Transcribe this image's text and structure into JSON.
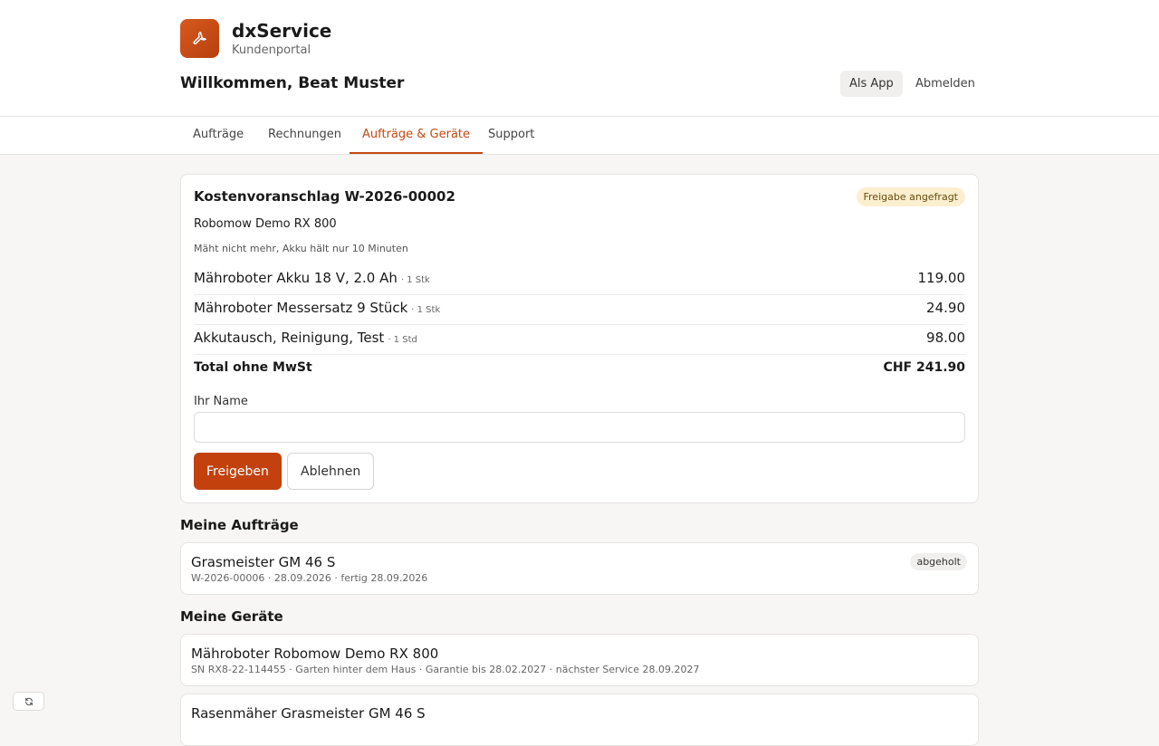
{
  "brand": {
    "name": "dxService",
    "subtitle": "Kundenportal",
    "accent_color": "#c2410c",
    "logo_icon": "wrench-icon"
  },
  "header": {
    "welcome": "Willkommen, Beat Muster",
    "app_button": "Als App",
    "logout_button": "Abmelden"
  },
  "tabs": [
    {
      "label": "Aufträge",
      "active": false
    },
    {
      "label": "Rechnungen",
      "active": false
    },
    {
      "label": "Aufträge & Geräte",
      "active": true
    },
    {
      "label": "Support",
      "active": false
    }
  ],
  "quote": {
    "title": "Kostenvoranschlag W-2026-00002",
    "status": "Freigabe angefragt",
    "device": "Robomow Demo RX 800",
    "issue": "Mäht nicht mehr, Akku hält nur 10 Minuten",
    "items": [
      {
        "name": "Mähroboter Akku 18 V, 2.0 Ah",
        "qty": "· 1 Stk",
        "price": "119.00"
      },
      {
        "name": "Mähroboter Messersatz 9 Stück",
        "qty": "· 1 Stk",
        "price": "24.90"
      },
      {
        "name": "Akkutausch, Reinigung, Test",
        "qty": "· 1 Std",
        "price": "98.00"
      }
    ],
    "total_label": "Total ohne MwSt",
    "total_value": "CHF 241.90",
    "name_label": "Ihr Name",
    "name_value": "",
    "approve_button": "Freigeben",
    "reject_button": "Ablehnen"
  },
  "orders": {
    "title": "Meine Aufträge",
    "items": [
      {
        "title": "Grasmeister GM 46 S",
        "meta": "W-2026-00006 · 28.09.2026 · fertig 28.09.2026",
        "badge": "abgeholt"
      }
    ]
  },
  "devices": {
    "title": "Meine Geräte",
    "items": [
      {
        "title": "Mähroboter Robomow Demo RX 800",
        "meta": "SN RX8-22-114455 · Garten hinter dem Haus · Garantie bis 28.02.2027 · nächster Service 28.09.2027"
      },
      {
        "title": "Rasenmäher Grasmeister GM 46 S",
        "meta": ""
      }
    ]
  },
  "floating": {
    "icon": "refresh-icon"
  }
}
